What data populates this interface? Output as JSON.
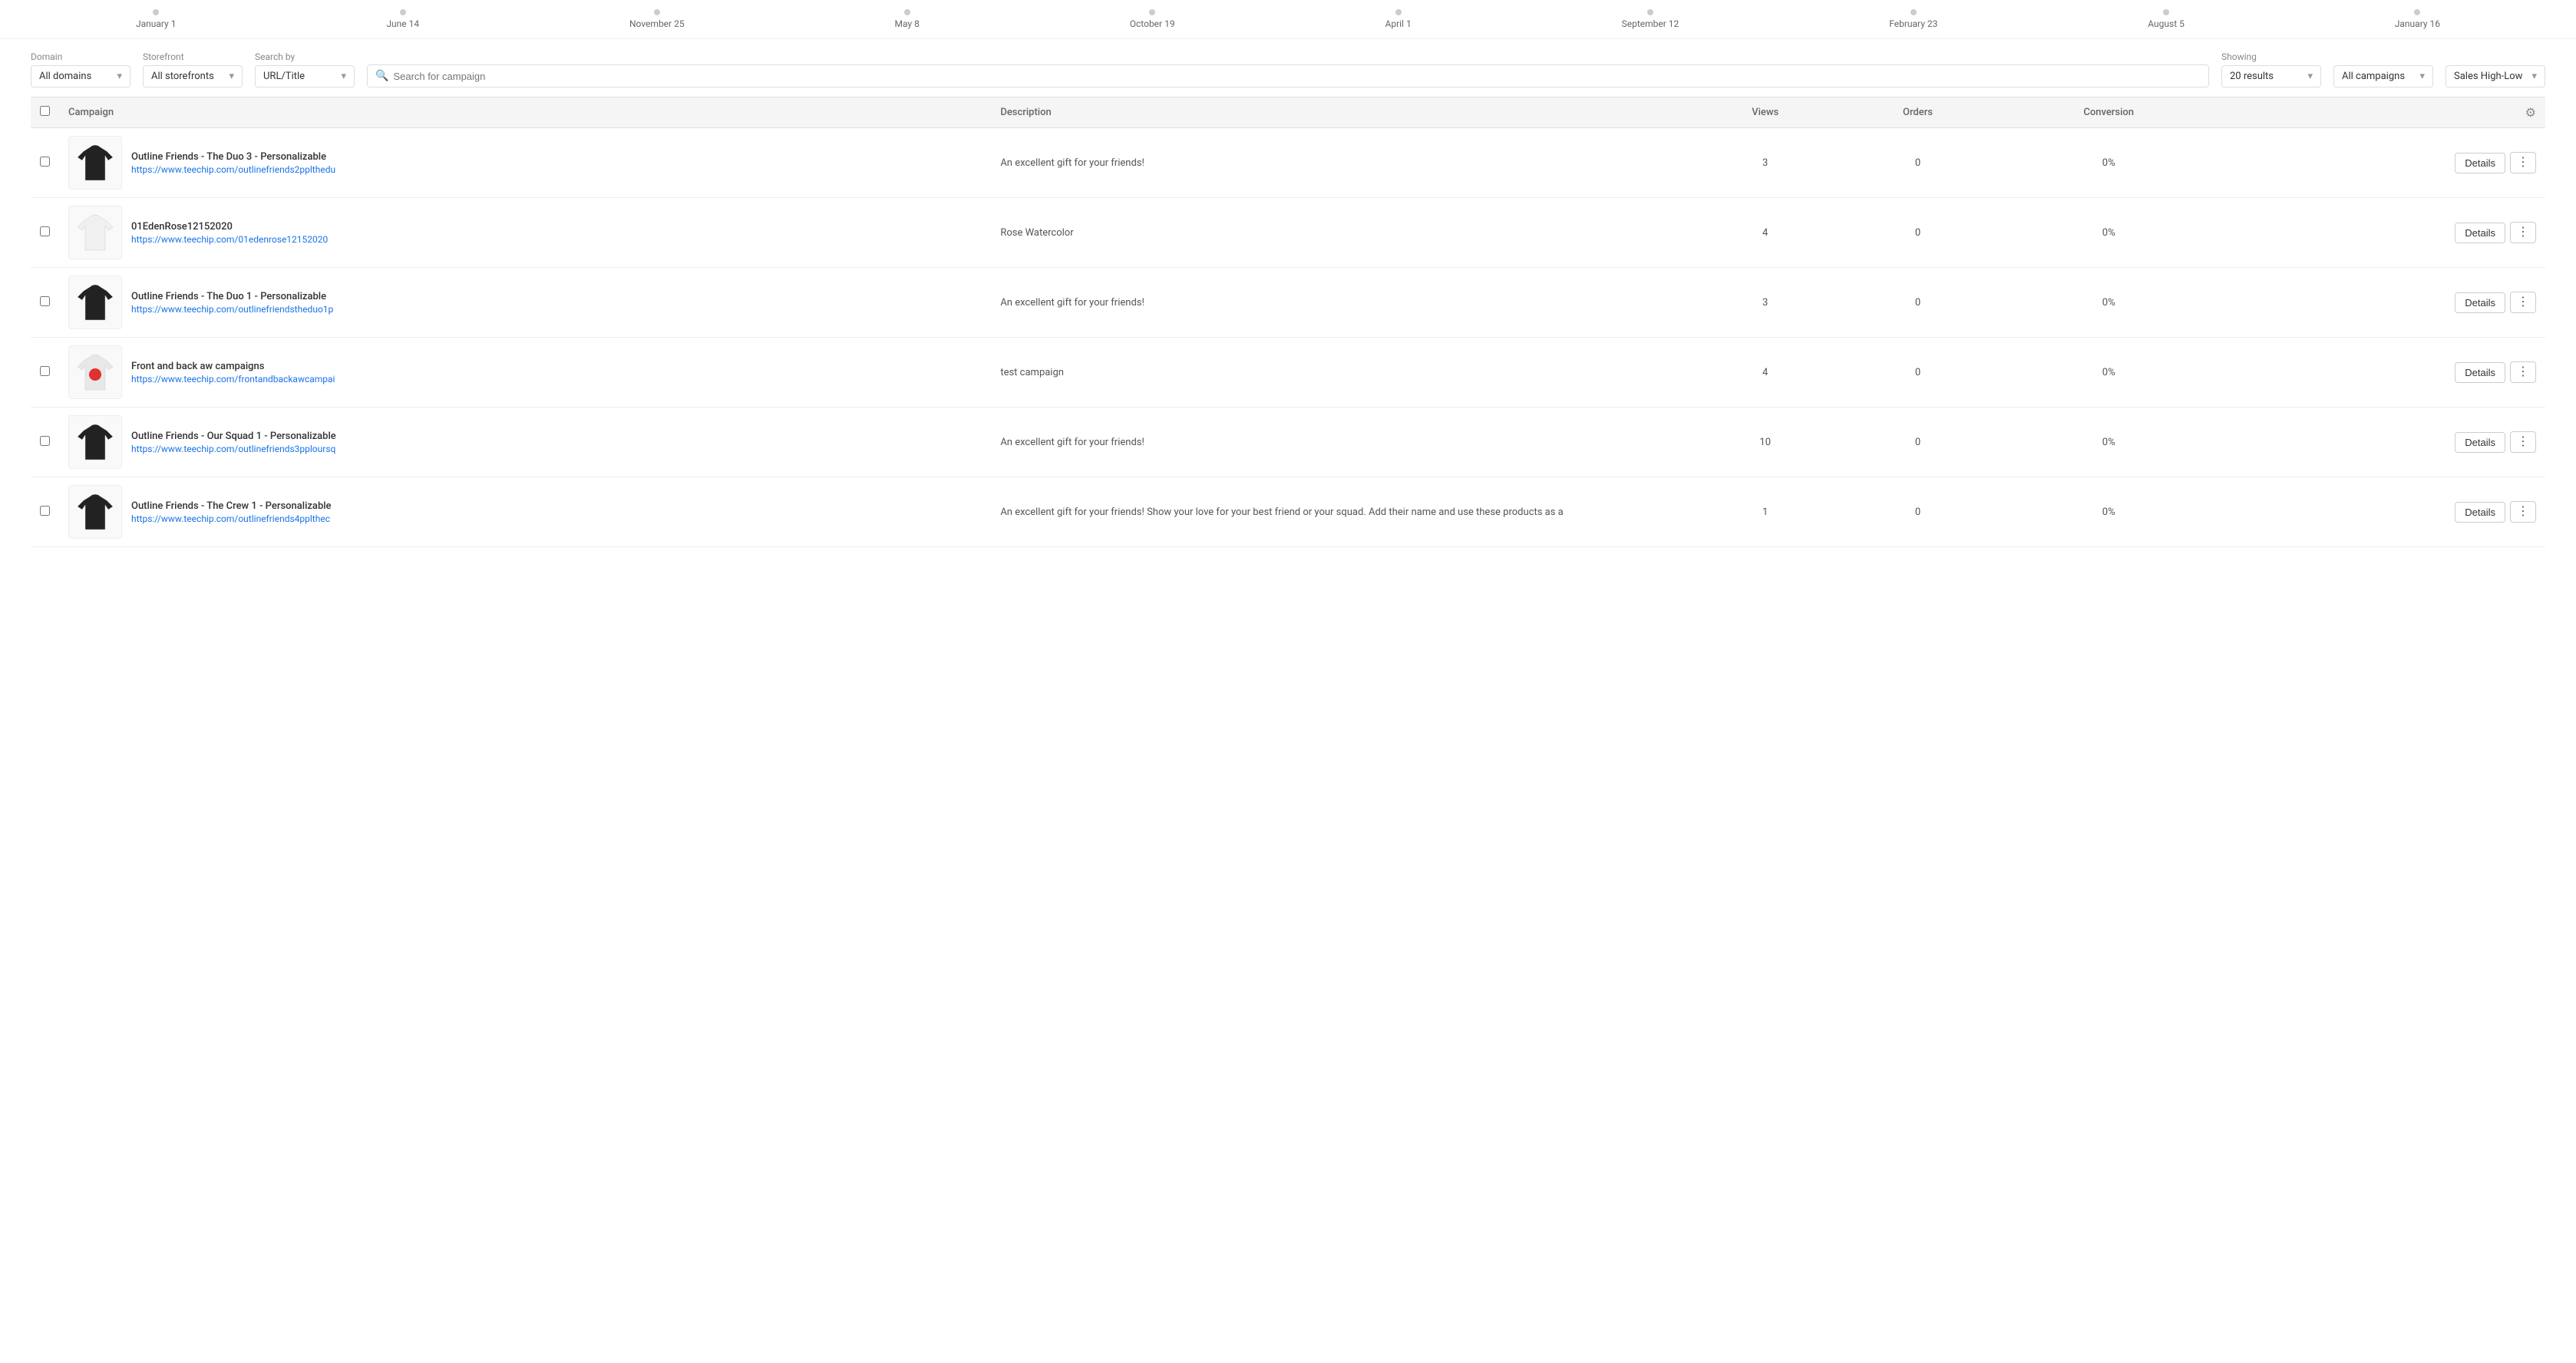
{
  "timeline": {
    "dates": [
      "January 1",
      "June 14",
      "November 25",
      "May 8",
      "October 19",
      "April 1",
      "September 12",
      "February 23",
      "August 5",
      "January 16"
    ]
  },
  "filters": {
    "domain_label": "Domain",
    "domain_value": "All domains",
    "storefront_label": "Storefront",
    "storefront_value": "All storefronts",
    "searchby_label": "Search by",
    "searchby_value": "URL/Title",
    "search_placeholder": "Search for campaign",
    "showing_label": "Showing",
    "showing_value": "20 results",
    "campaigns_value": "All campaigns",
    "sort_value": "Sales High-Low"
  },
  "table": {
    "headers": {
      "campaign": "Campaign",
      "description": "Description",
      "views": "Views",
      "orders": "Orders",
      "conversion": "Conversion"
    },
    "rows": [
      {
        "id": 1,
        "name": "Outline Friends - The Duo 3 - Personalizable",
        "url": "https://www.teechip.com/outlinefriends2pplthedu",
        "url_display": "https://www.teechip.com/outlinefriends2pplthedu",
        "description": "An excellent gift for your friends!",
        "views": 3,
        "orders": 0,
        "conversion": "0%",
        "shirt_color": "black"
      },
      {
        "id": 2,
        "name": "01EdenRose12152020",
        "url": "https://www.teechip.com/01edenrose12152020",
        "url_display": "https://www.teechip.com/01edenrose12152020",
        "description": "Rose Watercolor",
        "views": 4,
        "orders": 0,
        "conversion": "0%",
        "shirt_color": "white"
      },
      {
        "id": 3,
        "name": "Outline Friends - The Duo 1 - Personalizable",
        "url": "https://www.teechip.com/outlinefriendsthedup1p",
        "url_display": "https://www.teechip.com/outlinefriendstheduo1p",
        "description": "An excellent gift for your friends!",
        "views": 3,
        "orders": 0,
        "conversion": "0%",
        "shirt_color": "black"
      },
      {
        "id": 4,
        "name": "Front and back aw campaigns",
        "url": "https://www.teechip.com/frontandbackawcampai",
        "url_display": "https://www.teechip.com/frontandbackawcampai",
        "description": "test campaign",
        "views": 4,
        "orders": 0,
        "conversion": "0%",
        "shirt_color": "white_red"
      },
      {
        "id": 5,
        "name": "Outline Friends - Our Squad 1 - Personalizable",
        "url": "https://www.teechip.com/outlinefriends3pploursq",
        "url_display": "https://www.teechip.com/outlinefriends3pploursq",
        "description": "An excellent gift for your friends!",
        "views": 10,
        "orders": 0,
        "conversion": "0%",
        "shirt_color": "black"
      },
      {
        "id": 6,
        "name": "Outline Friends - The Crew 1 - Personalizable",
        "url": "https://www.teechip.com/outlinefriends4pplthec",
        "url_display": "https://www.teechip.com/outlinefriends4pplthec",
        "description": "An excellent gift for your friends! Show your love for your best friend or your squad. Add their name and use these products as a",
        "views": 1,
        "orders": 0,
        "conversion": "0%",
        "shirt_color": "black"
      }
    ],
    "details_label": "Details"
  }
}
